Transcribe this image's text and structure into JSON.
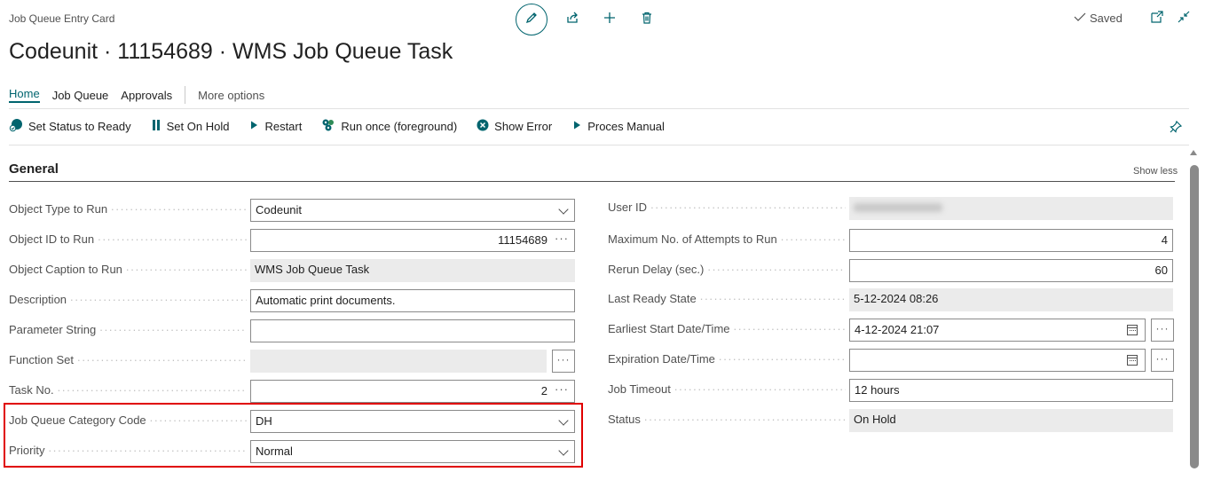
{
  "header": {
    "card_type": "Job Queue Entry Card",
    "title": "Codeunit · 11154689 · WMS Job Queue Task",
    "saved_label": "Saved"
  },
  "tabs": [
    {
      "label": "Home",
      "active": true
    },
    {
      "label": "Job Queue",
      "active": false
    },
    {
      "label": "Approvals",
      "active": false
    },
    {
      "label": "More options",
      "active": false
    }
  ],
  "actions": [
    {
      "label": "Set Status to Ready",
      "icon": "status-ready-icon"
    },
    {
      "label": "Set On Hold",
      "icon": "pause-icon"
    },
    {
      "label": "Restart",
      "icon": "play-icon"
    },
    {
      "label": "Run once (foreground)",
      "icon": "run-once-icon"
    },
    {
      "label": "Show Error",
      "icon": "error-icon"
    },
    {
      "label": "Proces Manual",
      "icon": "play-icon"
    }
  ],
  "section": {
    "title": "General",
    "toggle_label": "Show less"
  },
  "left_fields": [
    {
      "label": "Object Type to Run",
      "value": "Codeunit",
      "kind": "dropdown"
    },
    {
      "label": "Object ID to Run",
      "value": "11154689",
      "kind": "lookup"
    },
    {
      "label": "Object Caption to Run",
      "value": "WMS Job Queue Task",
      "kind": "readonly"
    },
    {
      "label": "Description",
      "value": "Automatic print documents.",
      "kind": "text"
    },
    {
      "label": "Parameter String",
      "value": "",
      "kind": "text"
    },
    {
      "label": "Function Set",
      "value": "",
      "kind": "readonly-lookup"
    },
    {
      "label": "Task No.",
      "value": "2",
      "kind": "lookup"
    },
    {
      "label": "Job Queue Category Code",
      "value": "DH",
      "kind": "dropdown"
    },
    {
      "label": "Priority",
      "value": "Normal",
      "kind": "dropdown"
    }
  ],
  "right_fields": [
    {
      "label": "User ID",
      "value": "",
      "kind": "readonly-redacted"
    },
    {
      "label": "Maximum No. of Attempts to Run",
      "value": "4",
      "kind": "number"
    },
    {
      "label": "Rerun Delay (sec.)",
      "value": "60",
      "kind": "number"
    },
    {
      "label": "Last Ready State",
      "value": "5-12-2024 08:26",
      "kind": "readonly"
    },
    {
      "label": "Earliest Start Date/Time",
      "value": "4-12-2024 21:07",
      "kind": "datetime"
    },
    {
      "label": "Expiration Date/Time",
      "value": "",
      "kind": "datetime"
    },
    {
      "label": "Job Timeout",
      "value": "12 hours",
      "kind": "text"
    },
    {
      "label": "Status",
      "value": "On Hold",
      "kind": "readonly"
    }
  ],
  "ellipsis_glyph": "···",
  "colors": {
    "accent": "#00646e",
    "highlight_border": "#e00000",
    "readonly_bg": "#ebebeb"
  }
}
